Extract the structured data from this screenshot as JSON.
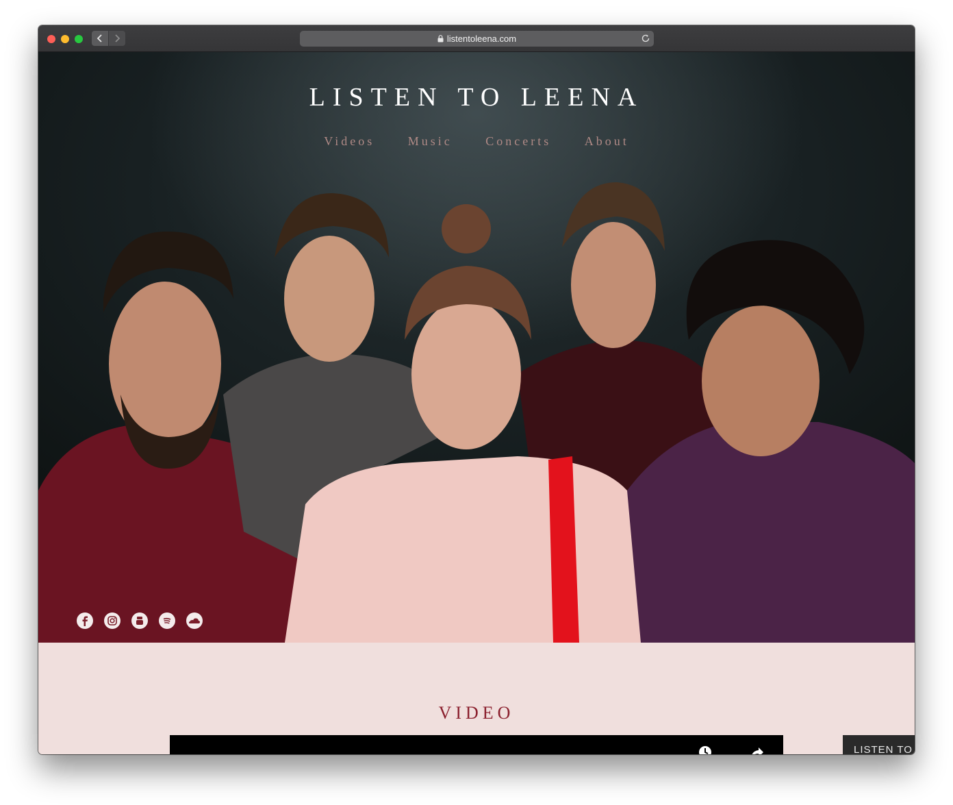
{
  "browser": {
    "url": "listentoleena.com"
  },
  "site": {
    "title": "LISTEN TO LEENA",
    "nav": [
      "Videos",
      "Music",
      "Concerts",
      "About"
    ]
  },
  "social": {
    "icons": [
      "facebook-icon",
      "instagram-icon",
      "youtube-icon",
      "spotify-icon",
      "soundcloud-icon"
    ]
  },
  "video_section": {
    "heading": "VIDEO",
    "side_thumb_text": "LISTEN TO"
  },
  "colors": {
    "accent": "#8a1f2d",
    "page_background": "#f0dfdd",
    "nav_text": "#b08a86"
  }
}
